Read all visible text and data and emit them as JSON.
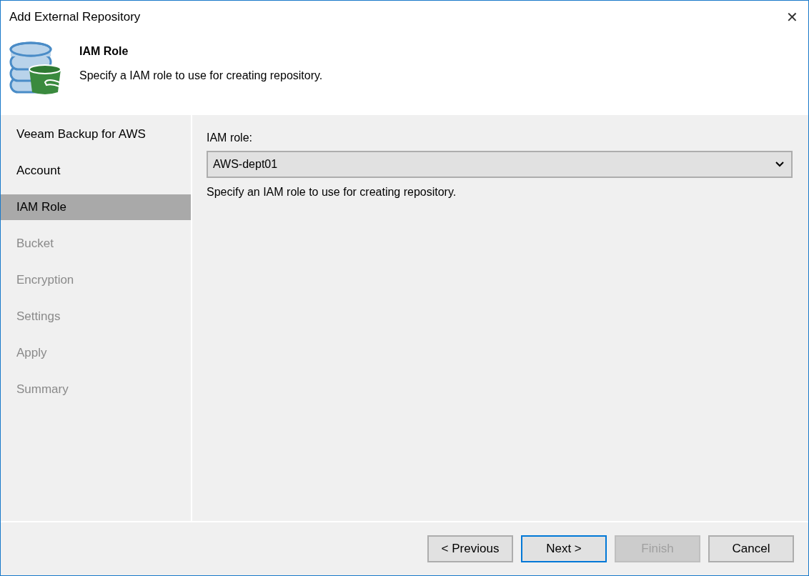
{
  "window": {
    "title": "Add External Repository",
    "close": "✕"
  },
  "header": {
    "title": "IAM Role",
    "subtitle": "Specify a IAM role to use for creating repository."
  },
  "steps": [
    {
      "label": "Veeam Backup for AWS",
      "selected": false,
      "disabled": false
    },
    {
      "label": "Account",
      "selected": false,
      "disabled": false
    },
    {
      "label": "IAM Role",
      "selected": true,
      "disabled": false
    },
    {
      "label": "Bucket",
      "selected": false,
      "disabled": true
    },
    {
      "label": "Encryption",
      "selected": false,
      "disabled": true
    },
    {
      "label": "Settings",
      "selected": false,
      "disabled": true
    },
    {
      "label": "Apply",
      "selected": false,
      "disabled": true
    },
    {
      "label": "Summary",
      "selected": false,
      "disabled": true
    }
  ],
  "form": {
    "label": "IAM role:",
    "value": "AWS-dept01",
    "hint": "Specify an IAM role to use for creating repository."
  },
  "buttons": [
    {
      "label": "< Previous",
      "kind": "normal"
    },
    {
      "label": "Next >",
      "kind": "default"
    },
    {
      "label": "Finish",
      "kind": "disabled"
    },
    {
      "label": "Cancel",
      "kind": "normal"
    }
  ]
}
